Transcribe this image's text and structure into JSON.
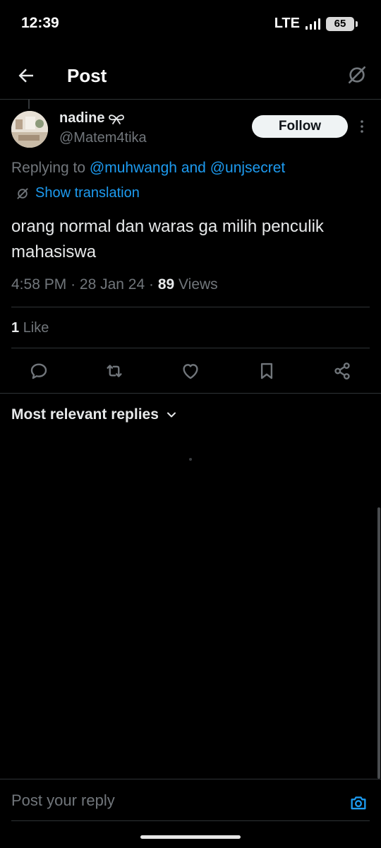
{
  "status_bar": {
    "time": "12:39",
    "network": "LTE",
    "battery": "65"
  },
  "header": {
    "title": "Post"
  },
  "post": {
    "author_name": "nadine",
    "author_handle": "@Matem4tika",
    "follow_label": "Follow",
    "replying_prefix": "Replying to",
    "reply_to_1": "@muhwangh",
    "reply_to_joiner": "and",
    "reply_to_2": "@unjsecret",
    "show_translation_label": "Show translation",
    "text": "orang normal dan waras ga milih penculik mahasiswa",
    "time": "4:58 PM",
    "date": "28 Jan 24",
    "views_count": "89",
    "views_label": "Views",
    "likes_count": "1",
    "likes_label": "Like"
  },
  "replies": {
    "sort_label": "Most relevant replies"
  },
  "reply_bar": {
    "placeholder": "Post your reply"
  },
  "colors": {
    "background": "#000000",
    "accent": "#1d9bf0",
    "muted": "#71767b",
    "text": "#e7e9ea",
    "divider": "#2f3336"
  }
}
